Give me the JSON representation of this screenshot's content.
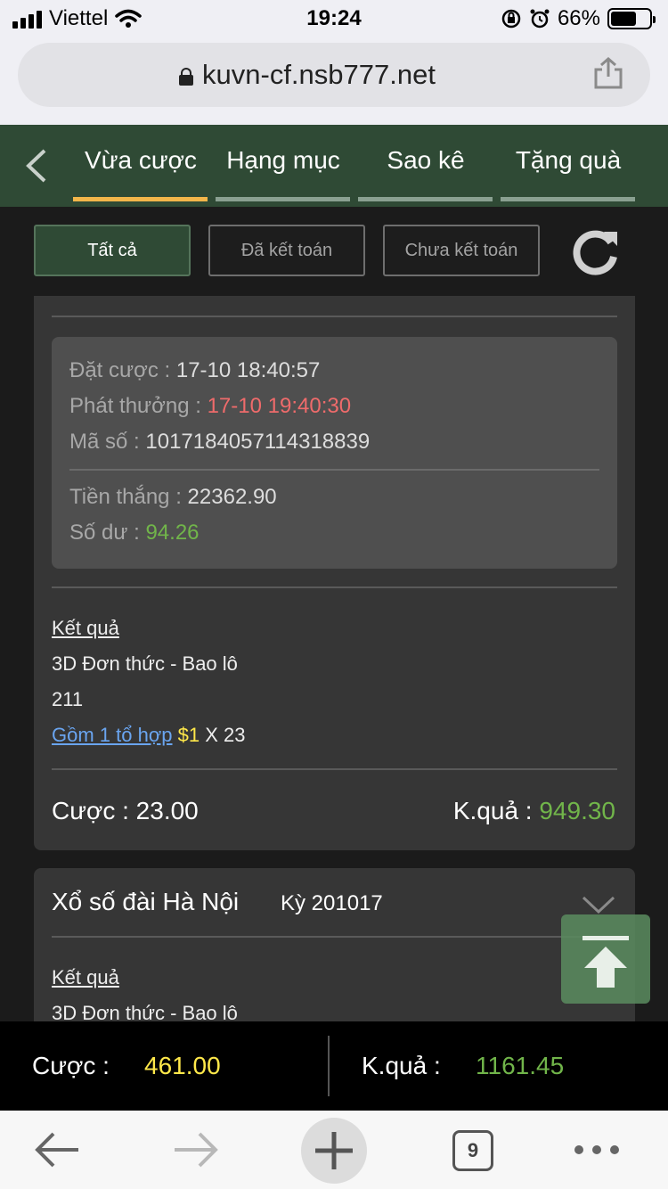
{
  "status": {
    "carrier": "Viettel",
    "time": "19:24",
    "battery": "66%"
  },
  "browser": {
    "url": "kuvn-cf.nsb777.net",
    "tab_count": "9"
  },
  "tabs": [
    {
      "label": "Vừa cược",
      "active": true
    },
    {
      "label": "Hạng mục",
      "active": false
    },
    {
      "label": "Sao kê",
      "active": false
    },
    {
      "label": "Tặng quà",
      "active": false
    }
  ],
  "filters": [
    {
      "label": "Tất cả",
      "active": true
    },
    {
      "label": "Đã kết toán",
      "active": false
    },
    {
      "label": "Chưa kết toán",
      "active": false
    }
  ],
  "card1": {
    "info": {
      "placed_label": "Đặt cược",
      "placed_value": "17-10 18:40:57",
      "payout_label": "Phát thưởng",
      "payout_value": "17-10 19:40:30",
      "code_label": "Mã số",
      "code_value": "1017184057114318839",
      "win_label": "Tiền thắng",
      "win_value": "22362.90",
      "balance_label": "Số dư",
      "balance_value": "94.26"
    },
    "result_link": "Kết quả",
    "bet_type": "3D Đơn thức - Bao lô",
    "number": "211",
    "combo_link": "Gồm 1 tổ hợp",
    "unit": "$1",
    "multiplier": "X 23",
    "stake_label": "Cược",
    "stake_value": "23.00",
    "result_label": "K.quả",
    "result_value": "949.30"
  },
  "card2": {
    "title": "Xổ số đài Hà Nội",
    "period": "Kỳ 201017",
    "result_link": "Kết quả",
    "bet_type": "3D Đơn thức - Bao lô"
  },
  "totals": {
    "stake_label": "Cược",
    "stake_value": "461.00",
    "result_label": "K.quả",
    "result_value": "1161.45"
  },
  "colors": {
    "header_green": "#2f4a35",
    "active_underline": "#f2b64a",
    "payout_red": "#ef6b6b",
    "positive_green": "#71b54a",
    "highlight_yellow": "#ffe84a",
    "link_blue": "#6aa5f0"
  }
}
